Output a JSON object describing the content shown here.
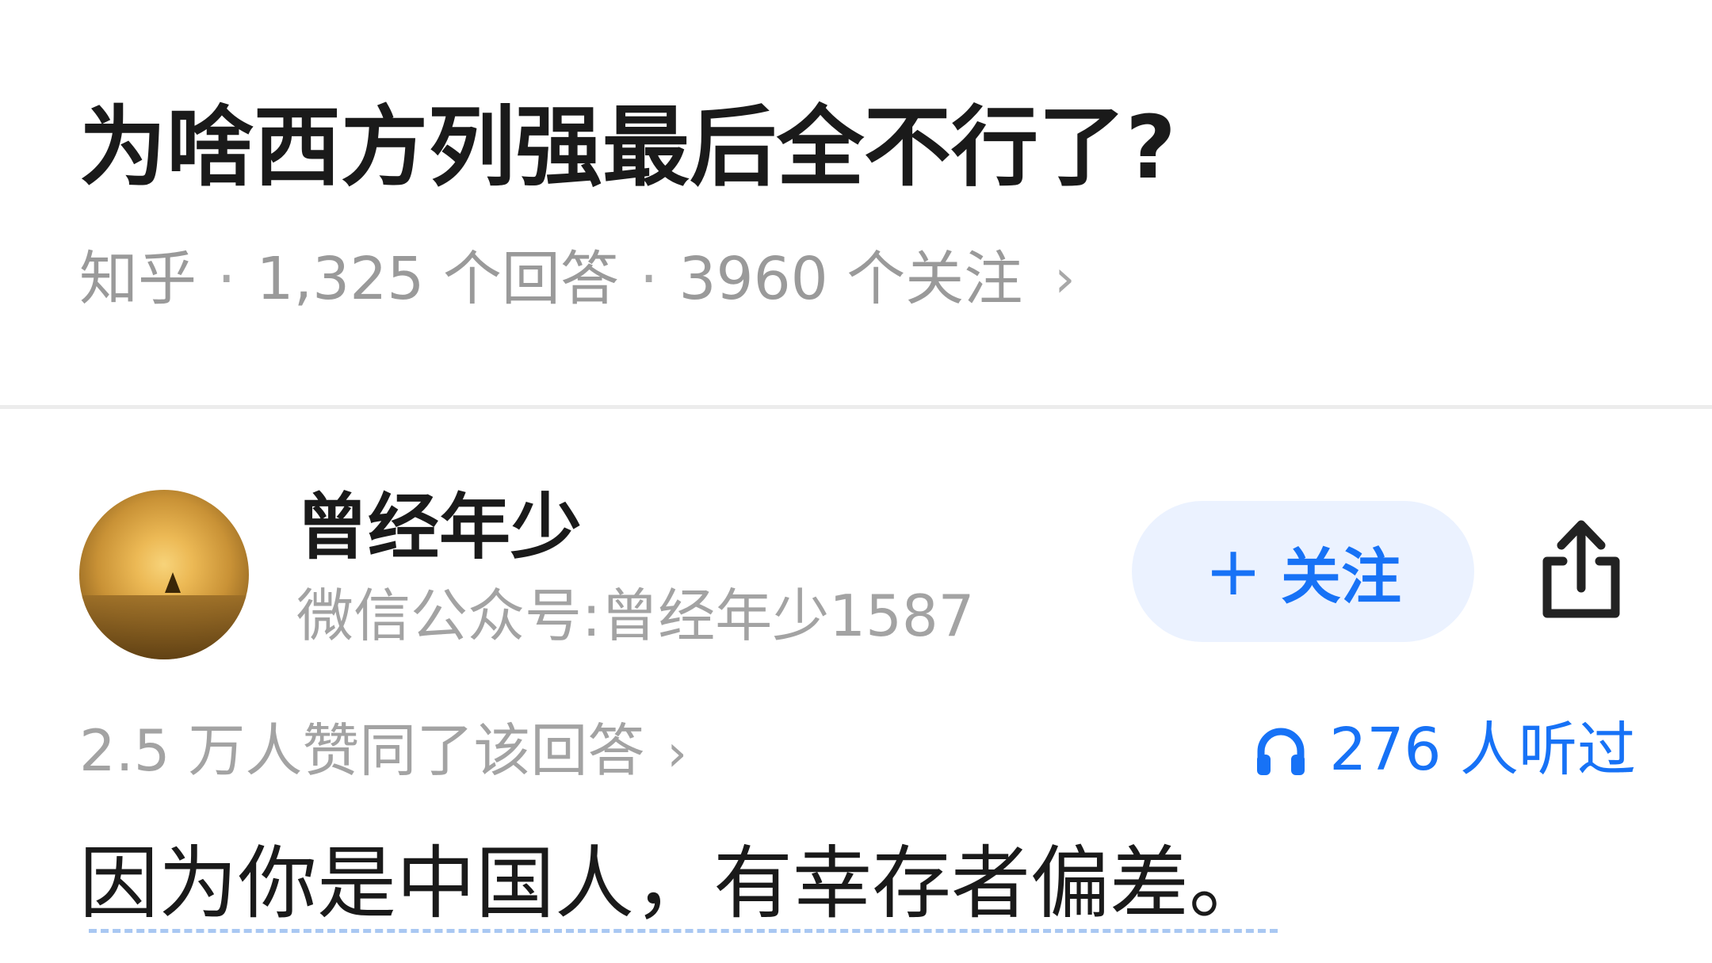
{
  "question": {
    "title": "为啥西方列强最后全不行了?",
    "source": "知乎",
    "answer_count": "1,325 个回答",
    "follower_count": "3960 个关注",
    "separator": "·",
    "chevron": "›"
  },
  "author": {
    "name": "曾经年少",
    "bio": "微信公众号:曾经年少1587",
    "avatar_icon": "sunset-sailboat-avatar"
  },
  "actions": {
    "follow_plus": "+",
    "follow_label": "关注",
    "share_icon": "share-icon"
  },
  "stats": {
    "votes": "2.5 万人赞同了该回答",
    "votes_chevron": "›",
    "listen_icon": "headphones-icon",
    "listen": "276 人听过"
  },
  "answer": {
    "first_line": "因为你是中国人，有幸存者偏差。"
  },
  "colors": {
    "accent": "#1772f6",
    "follow_bg": "#ebf2ff",
    "muted": "#9a9a9a",
    "divider": "#ececec"
  }
}
